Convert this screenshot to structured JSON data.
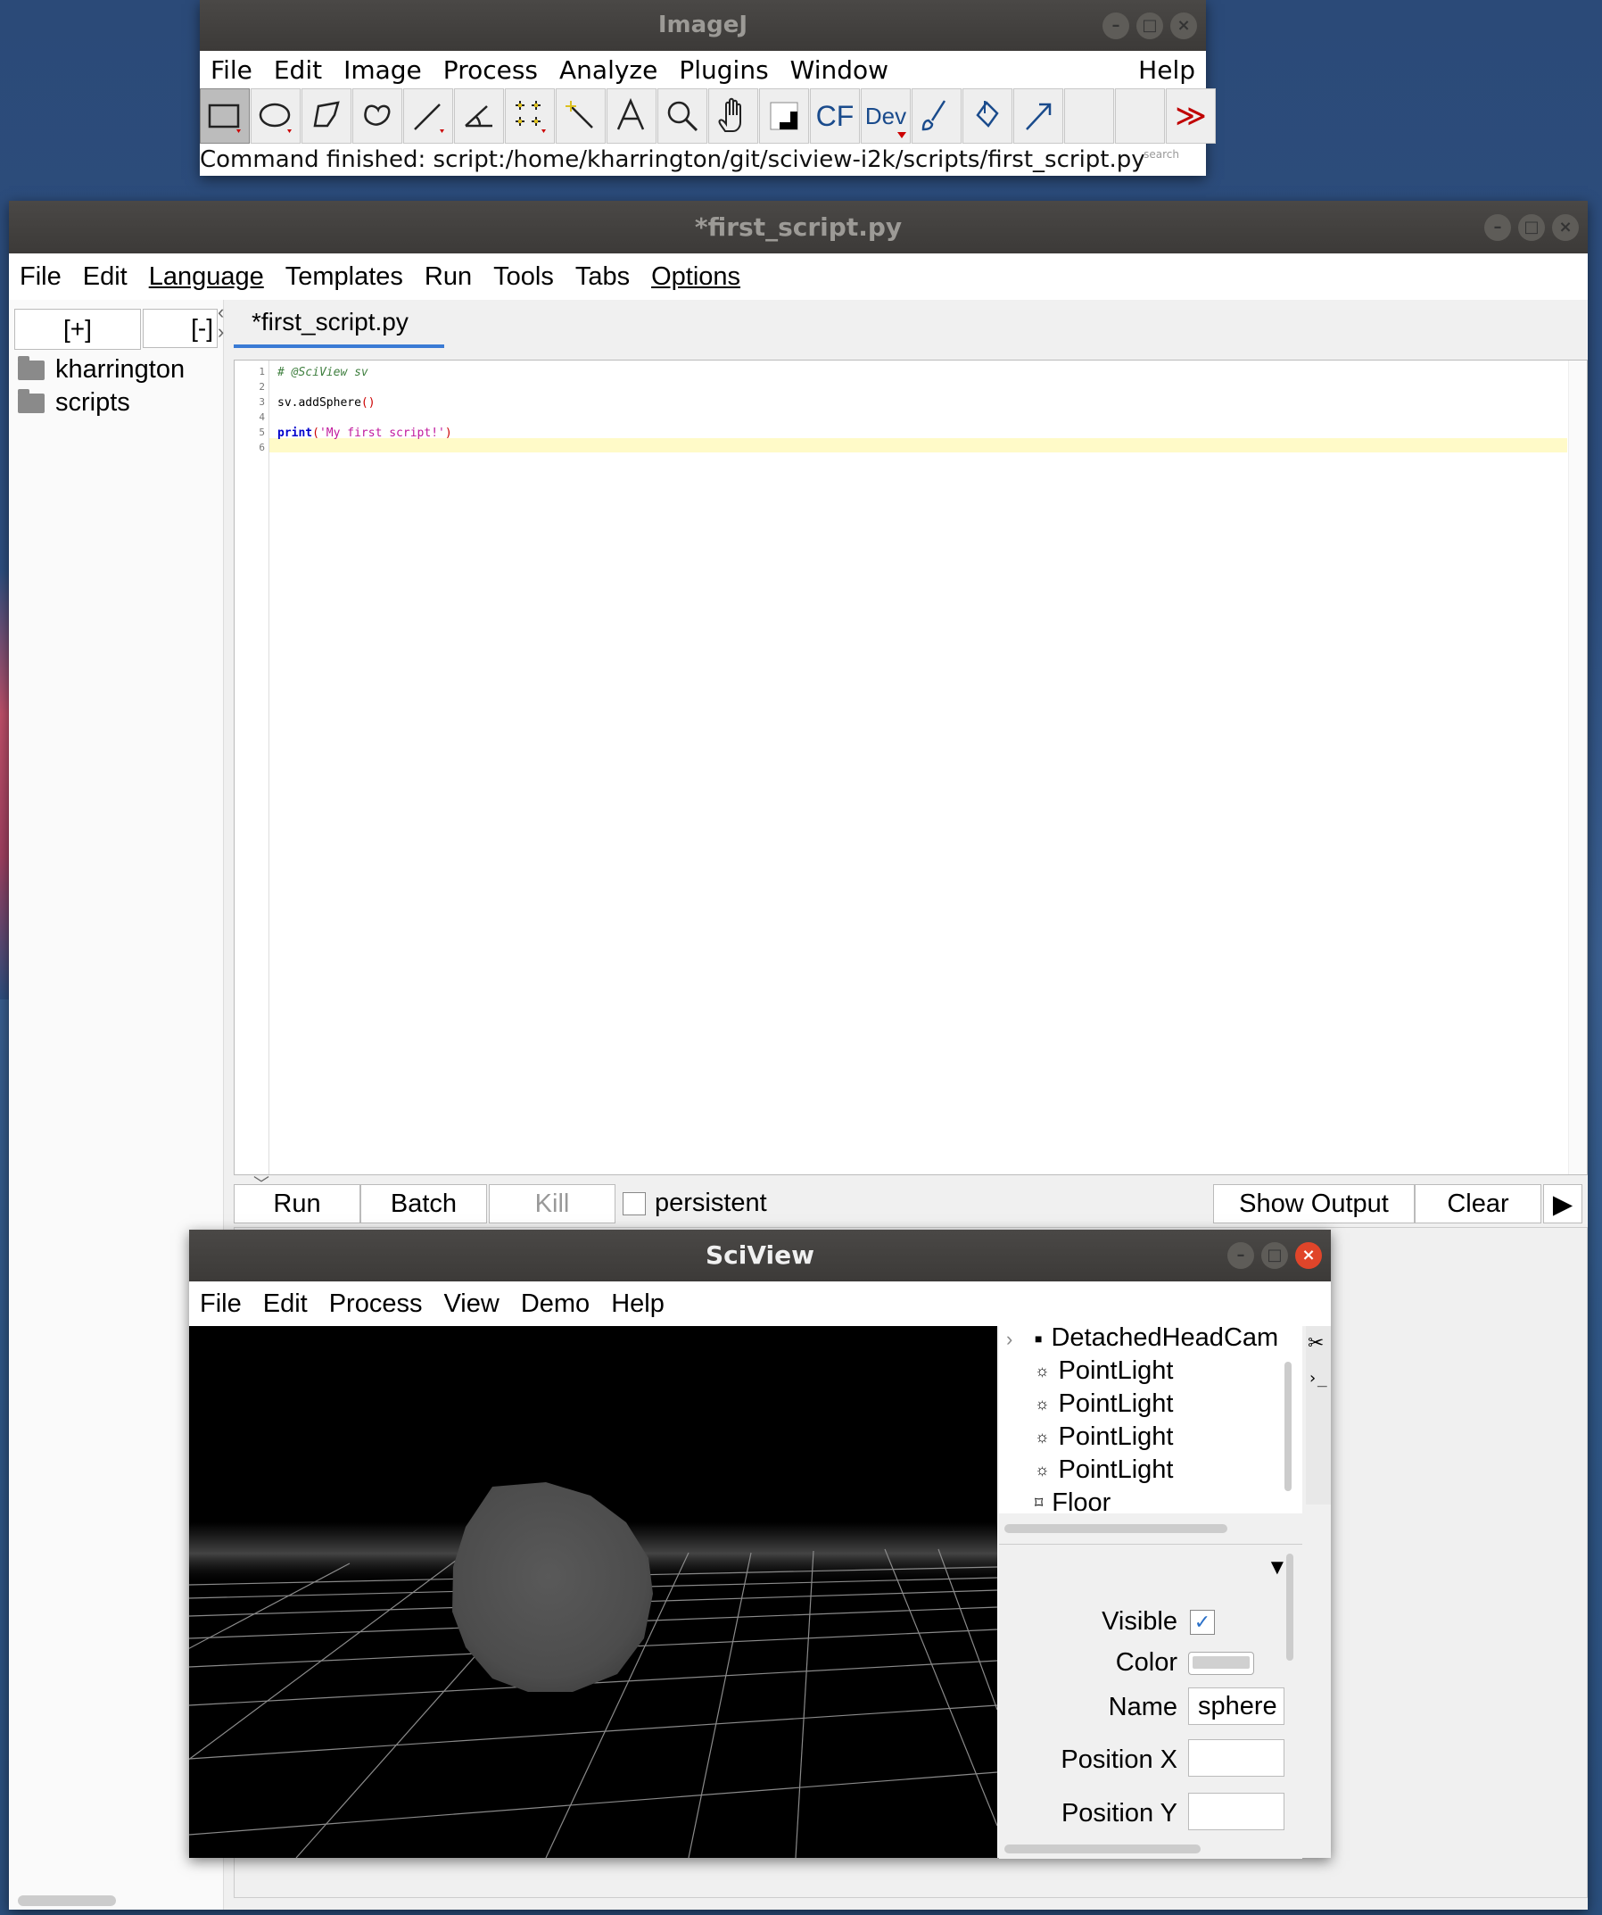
{
  "imagej": {
    "title": "ImageJ",
    "menu": [
      "File",
      "Edit",
      "Image",
      "Process",
      "Analyze",
      "Plugins",
      "Window"
    ],
    "help": "Help",
    "tools": [
      "rectangle-tool",
      "oval-tool",
      "polygon-tool",
      "freehand-tool",
      "line-tool",
      "angle-tool",
      "multipoint-tool",
      "wand-tool",
      "text-tool",
      "zoom-tool",
      "hand-tool",
      "color-picker-tool"
    ],
    "text_tools": {
      "cf": "CF",
      "dev": "Dev",
      "more": "≫"
    },
    "status": "Command finished: script:/home/kharrington/git/sciview-i2k/scripts/first_script.py",
    "search_hint": "search"
  },
  "editor": {
    "title": "*first_script.py",
    "menu": [
      "File",
      "Edit",
      "Language",
      "Templates",
      "Run",
      "Tools",
      "Tabs",
      "Options"
    ],
    "expand_label": "[+]",
    "collapse_label": "[-]",
    "tree": [
      "kharrington",
      "scripts"
    ],
    "tab_label": "*first_script.py",
    "line_numbers": [
      "1",
      "2",
      "3",
      "4",
      "5",
      "6"
    ],
    "code": {
      "line1": "# @SciView sv",
      "line3_a": "sv.addSphere",
      "line3_b": "()",
      "line5_a": "print",
      "line5_b": "(",
      "line5_c": "'My first script!'",
      "line5_d": ")"
    },
    "buttons": {
      "run": "Run",
      "batch": "Batch",
      "kill": "Kill",
      "persistent": "persistent",
      "show_output": "Show Output",
      "clear": "Clear",
      "more": "▶"
    },
    "colors": {
      "comment": "#3f7f3f",
      "string": "#c0189c",
      "keyword": "#0000cc",
      "paren": "#cc0000",
      "tab_accent": "#3a7bd5"
    }
  },
  "sciview": {
    "title": "SciView",
    "menu": [
      "File",
      "Edit",
      "Process",
      "View",
      "Demo",
      "Help"
    ],
    "nodes": [
      {
        "icon": "camera-icon",
        "glyph": "■",
        "label": "DetachedHeadCam"
      },
      {
        "icon": "light-icon",
        "glyph": "☼",
        "label": "PointLight"
      },
      {
        "icon": "light-icon",
        "glyph": "☼",
        "label": "PointLight"
      },
      {
        "icon": "light-icon",
        "glyph": "☼",
        "label": "PointLight"
      },
      {
        "icon": "light-icon",
        "glyph": "☼",
        "label": "PointLight"
      },
      {
        "icon": "mesh-icon",
        "glyph": "⌑",
        "label": "Floor"
      }
    ],
    "properties": {
      "visible_label": "Visible",
      "visible": true,
      "color_label": "Color",
      "color_value": "#d0d0d0",
      "name_label": "Name",
      "name_value": "sphere",
      "posx_label": "Position X",
      "posx_value": "",
      "posy_label": "Position Y",
      "posy_value": ""
    }
  }
}
